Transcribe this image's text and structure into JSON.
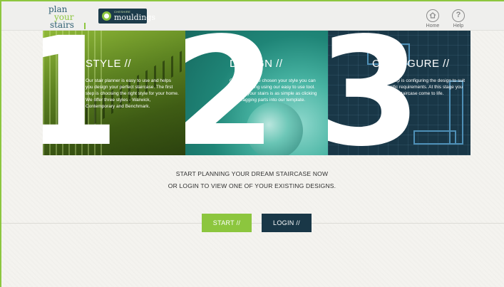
{
  "header": {
    "logo_line1": "plan",
    "logo_line2": "your",
    "logo_line3": "stairs",
    "brand_small": "CHESHIRE",
    "brand_name": "mouldings",
    "home_label": "Home",
    "help_label": "Help"
  },
  "panels": [
    {
      "number": "1",
      "title": "STYLE //",
      "body": "Our stair planner is easy to use and helps you design your perfect staircase. The first step is choosing the right style for your home. We offer three styles - Warwick, Contemporary and Benchmark."
    },
    {
      "number": "2",
      "title": "DESIGN //",
      "body": "Once you have chosen your style you can start designing using our easy to use tool. Building your stairs is as simple as clicking and dragging parts into our template."
    },
    {
      "number": "3",
      "title": "CONFIGURE //",
      "body": "The final step is configuring the design to suit your specific requirements. At this stage you will see your staircase come to life."
    }
  ],
  "cta": {
    "line1": "START PLANNING YOUR DREAM STAIRCASE NOW",
    "line2": "OR LOGIN TO VIEW ONE OF YOUR EXISTING DESIGNS."
  },
  "buttons": {
    "start": "START //",
    "login": "LOGIN //"
  },
  "colors": {
    "accent_green": "#8cc63e",
    "navy": "#193747"
  }
}
